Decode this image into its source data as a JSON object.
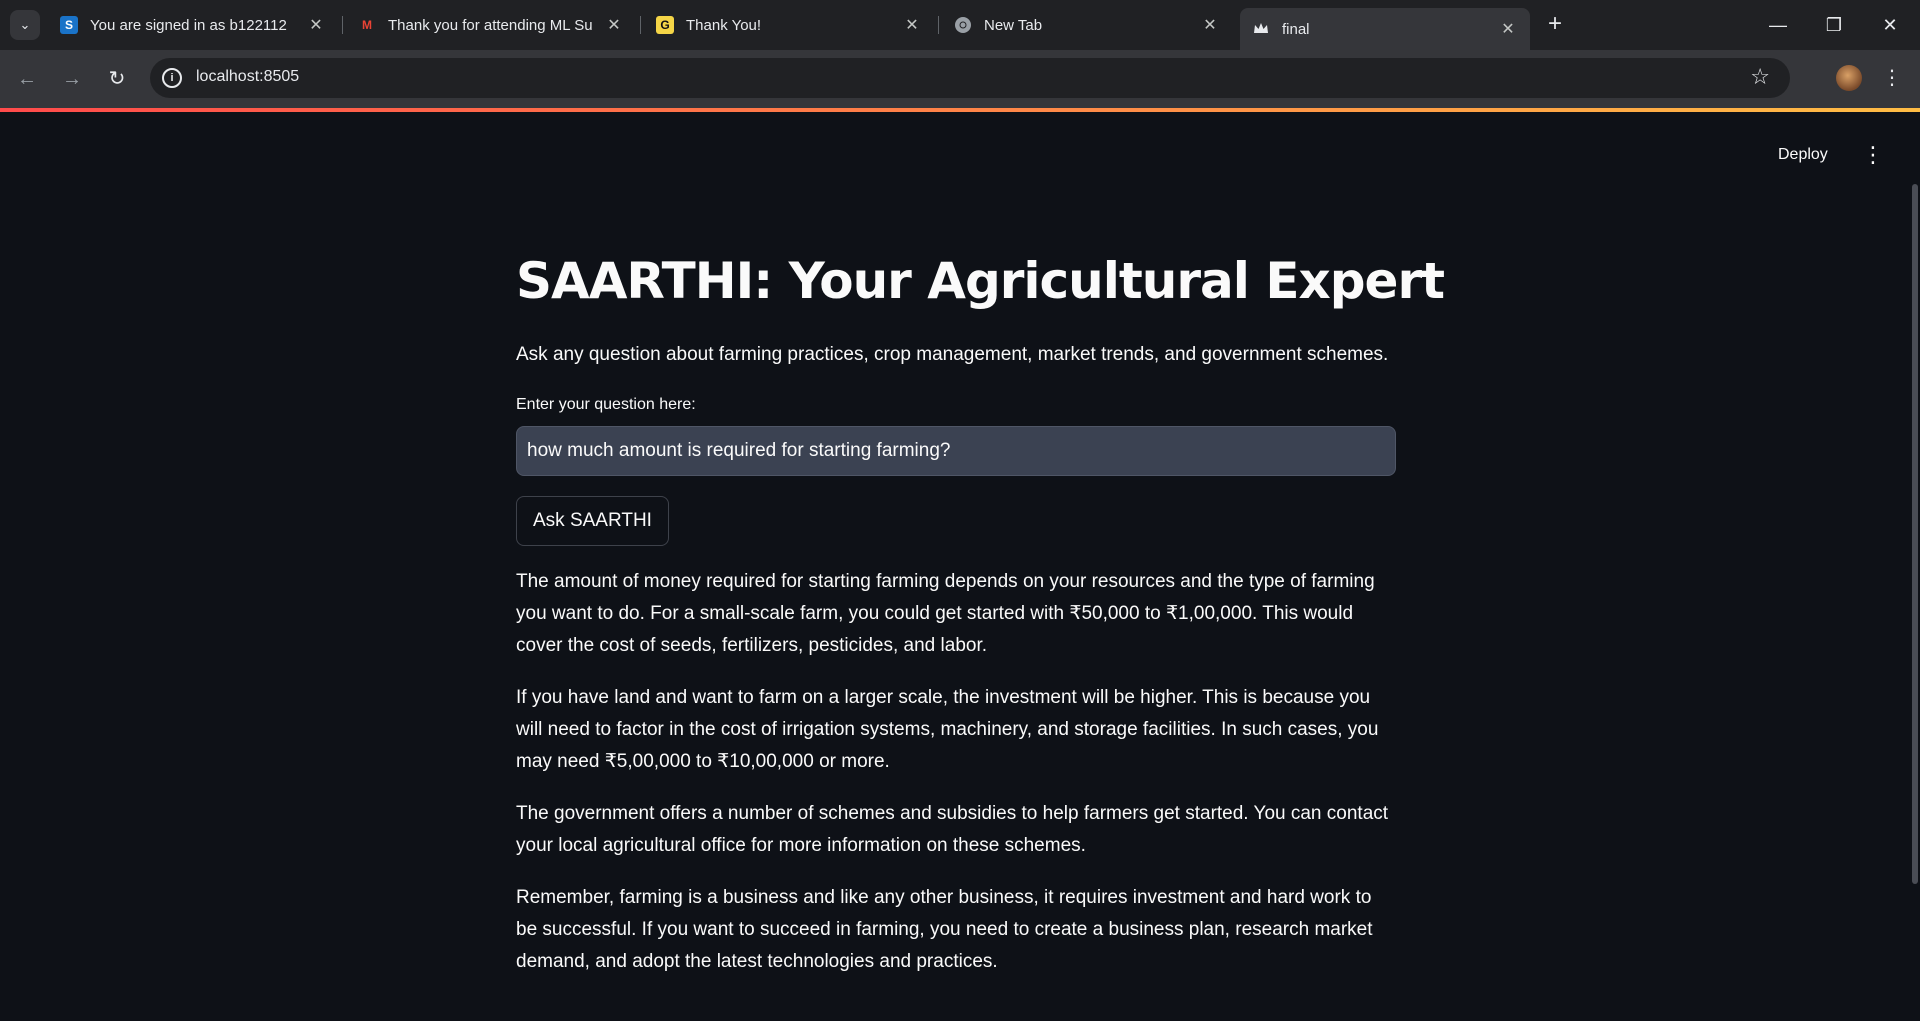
{
  "browser": {
    "tabs": [
      {
        "title": "You are signed in as b122112",
        "favicon": "S"
      },
      {
        "title": "Thank you for attending ML Su",
        "favicon": "M"
      },
      {
        "title": "Thank You!",
        "favicon": "G"
      },
      {
        "title": "New Tab",
        "favicon": "chrome-icon"
      },
      {
        "title": "final",
        "favicon": "crown-icon"
      }
    ],
    "active_tab": 4,
    "url": "localhost:8505"
  },
  "app": {
    "deploy_label": "Deploy",
    "title": "SAARTHI: Your Agricultural Expert",
    "subtitle": "Ask any question about farming practices, crop management, market trends, and government schemes.",
    "question_label": "Enter your question here:",
    "question_value": "how much amount is required for starting farming?",
    "ask_button_label": "Ask SAARTHI",
    "answer": [
      "The amount of money required for starting farming depends on your resources and the type of farming you want to do. For a small-scale farm, you could get started with ₹50,000 to ₹1,00,000. This would cover the cost of seeds, fertilizers, pesticides, and labor.",
      "If you have land and want to farm on a larger scale, the investment will be higher. This is because you will need to factor in the cost of irrigation systems, machinery, and storage facilities. In such cases, you may need ₹5,00,000 to ₹10,00,000 or more.",
      "The government offers a number of schemes and subsidies to help farmers get started. You can contact your local agricultural office for more information on these schemes.",
      "Remember, farming is a business and like any other business, it requires investment and hard work to be successful. If you want to succeed in farming, you need to create a business plan, research market demand, and adopt the latest technologies and practices."
    ]
  },
  "colors": {
    "background": "#0e1117",
    "input_bg": "#3b4252",
    "accent_start": "#ff4b4b",
    "accent_end": "#ffbd45"
  }
}
